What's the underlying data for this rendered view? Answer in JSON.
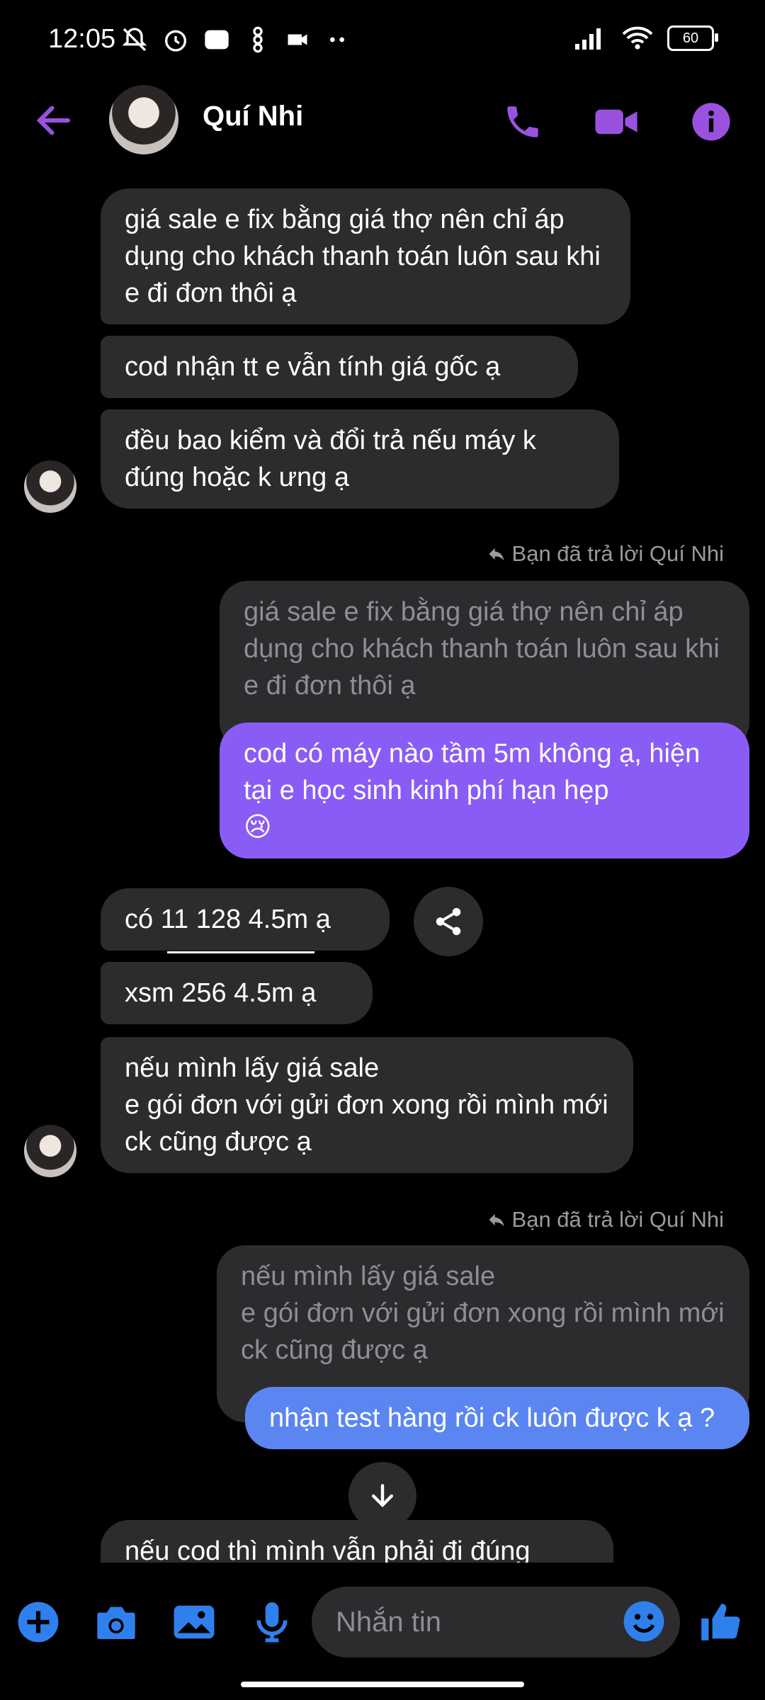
{
  "status_bar": {
    "time": "12:05",
    "battery": "60"
  },
  "header": {
    "contact_name": "Quí Nhi"
  },
  "messages": {
    "m1": "giá sale e fix bằng giá thợ nên chỉ áp dụng cho khách thanh toán luôn sau khi e đi đơn thôi ạ",
    "m2": "cod nhận tt e vẫn tính giá gốc ạ",
    "m3": "đều bao kiểm và đổi trả nếu máy k đúng hoặc k ưng ạ",
    "reply_note_1": "Bạn đã trả lời Quí Nhi",
    "quote_1": "giá sale e fix bằng giá thợ nên chỉ áp dụng cho khách thanh toán luôn sau khi e đi đơn thôi ạ",
    "m4": "cod có máy nào tầm 5m không ạ, hiện tại e học sinh kinh phí hạn hẹp",
    "m4_emoji": "😢",
    "m5": "có 11 128 4.5m ạ",
    "m6": "xsm 256 4.5m ạ",
    "m7": "nếu mình lấy giá sale\ne gói đơn với gửi đơn xong rồi mình mới ck cũng được ạ",
    "reply_note_2": "Bạn đã trả lời Quí Nhi",
    "quote_2": "nếu mình lấy giá sale\ne gói đơn với gửi đơn xong rồi mình mới ck cũng được ạ",
    "m8": "nhận test hàng rồi ck luôn được k ạ ?",
    "m9": "nếu cod thì mình vẫn phải đi đúng"
  },
  "composer": {
    "placeholder": "Nhắn tin"
  },
  "colors": {
    "accent": "#9b51e0",
    "purple_bubble": "#8a5cf6",
    "blue_bubble": "#5b86f1",
    "incoming_bubble": "#2c2c2e"
  }
}
